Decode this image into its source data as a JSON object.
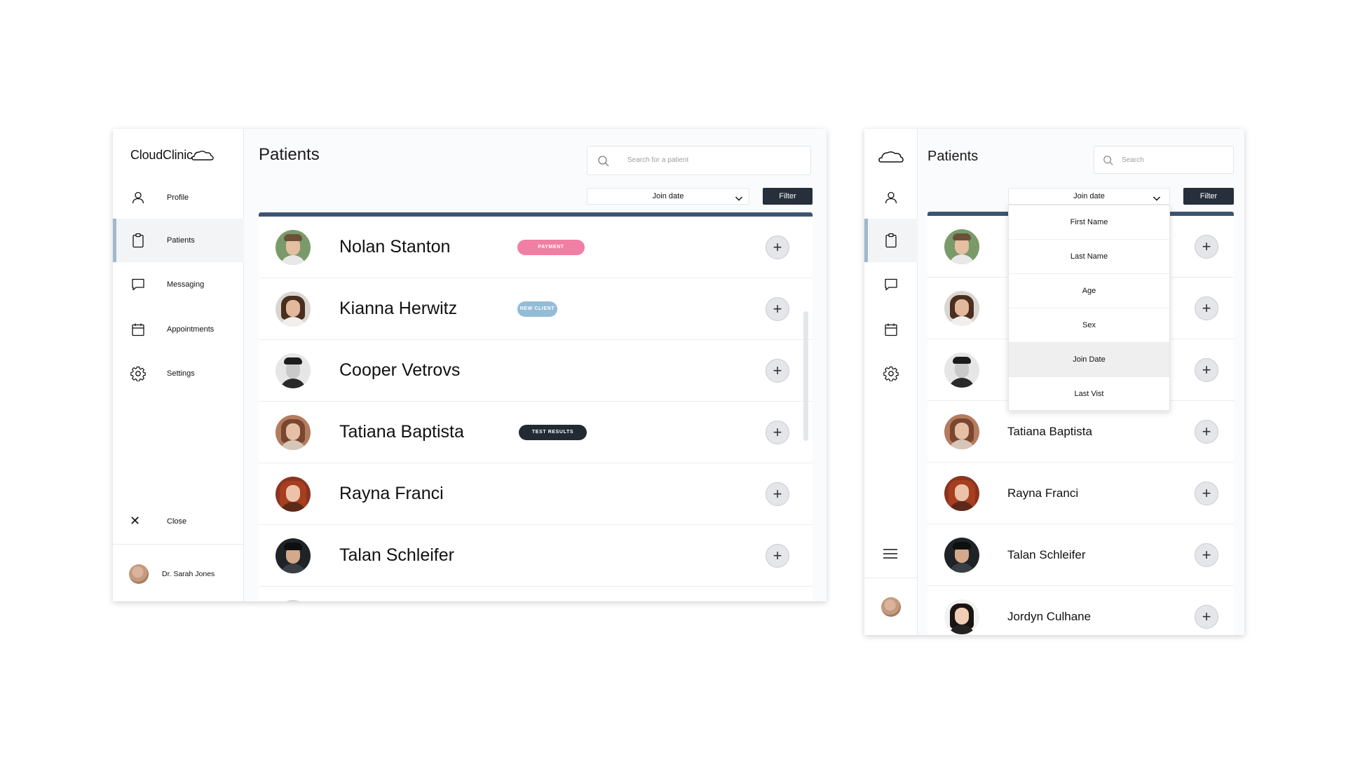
{
  "app_name": "CloudClinic",
  "page_title": "Patients",
  "nav": [
    {
      "label": "Profile",
      "icon": "user-icon"
    },
    {
      "label": "Patients",
      "icon": "clipboard-icon",
      "active": true
    },
    {
      "label": "Messaging",
      "icon": "chat-icon"
    },
    {
      "label": "Appointments",
      "icon": "calendar-icon"
    },
    {
      "label": "Settings",
      "icon": "gear-icon"
    }
  ],
  "close_label": "Close",
  "user_name": "Dr. Sarah Jones",
  "search_placeholder_wide": "Search for a patient",
  "search_placeholder_compact": "Search",
  "sort_select_value": "Join date",
  "filter_label": "Filter",
  "sort_options": [
    "First Name",
    "Last Name",
    "Age",
    "Sex",
    "Join Date",
    "Last Vist"
  ],
  "sort_selected_option": "Join Date",
  "patients": [
    {
      "name": "Nolan Stanton",
      "badge": "PAYMENT OUTSTANDING",
      "badge_color": "#f17ea3"
    },
    {
      "name": "Kianna Herwitz",
      "badge": "NEW CLIENT",
      "badge_color": "#93bcd6"
    },
    {
      "name": "Cooper Vetrovs",
      "badge": "",
      "badge_color": ""
    },
    {
      "name": "Tatiana Baptista",
      "badge": "TEST RESULTS RECEIVED",
      "badge_color": "#222a33"
    },
    {
      "name": "Rayna Franci",
      "badge": "",
      "badge_color": ""
    },
    {
      "name": "Talan Schleifer",
      "badge": "",
      "badge_color": ""
    },
    {
      "name": "Jordyn Culhane",
      "badge": "",
      "badge_color": ""
    }
  ],
  "add_button_symbol": "+",
  "colors": {
    "accent_bar": "#3d5472",
    "filter_button": "#262f3b",
    "active_nav_indicator": "#9fb8cc"
  }
}
